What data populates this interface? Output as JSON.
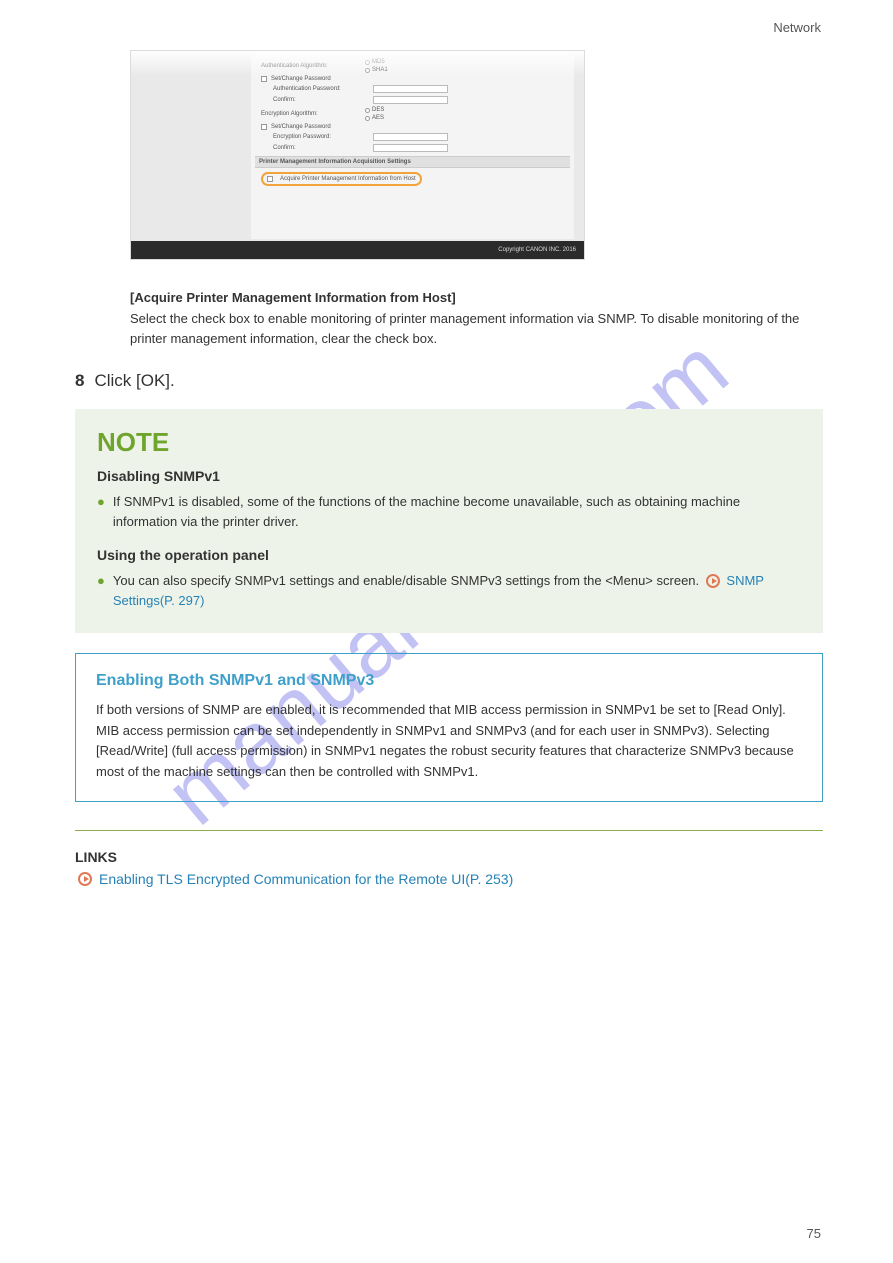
{
  "header": {
    "category": "Network"
  },
  "footer": {
    "page_number": "75"
  },
  "watermark": "manualshive.com",
  "screenshot": {
    "auth_algo_label": "Authentication Algorithm:",
    "auth_algo_opt1": "MD5",
    "auth_algo_opt2": "SHA1",
    "set_change_pw1": "Set/Change Password",
    "auth_pw_label": "Authentication Password:",
    "confirm1": "Confirm:",
    "enc_algo_label": "Encryption Algorithm:",
    "enc_algo_opt1": "DES",
    "enc_algo_opt2": "AES",
    "set_change_pw2": "Set/Change Password",
    "enc_pw_label": "Encryption Password:",
    "confirm2": "Confirm:",
    "section_header": "Printer Management Information Acquisition Settings",
    "highlight_label": "Acquire Printer Management Information from Host",
    "copyright": "Copyright CANON INC. 2016"
  },
  "option": {
    "title": "[Acquire Printer Management Information from Host]",
    "text": "Select the check box to enable monitoring of printer management information via SNMP. To disable monitoring of the printer management information, clear the check box."
  },
  "step": {
    "number": "8",
    "text": "Click [OK]."
  },
  "note": {
    "title": "NOTE",
    "subhead": "Disabling SNMPv1",
    "bullet_text_1": "If SNMPv1 is disabled, some of the functions of the machine become unavailable, such as obtaining machine information via the printer driver.",
    "panel_head": "Using the operation panel",
    "panel_bullet_1": "You can also specify SNMPv1 settings and enable/disable SNMPv3 settings from the <Menu> screen.",
    "panel_link": "SNMP Settings(P. 297)"
  },
  "opbox": {
    "title": "Enabling Both SNMPv1 and SNMPv3",
    "body": "If both versions of SNMP are enabled, it is recommended that MIB access permission in SNMPv1 be set to [Read Only]. MIB access permission can be set independently in SNMPv1 and SNMPv3 (and for each user in SNMPv3). Selecting [Read/Write] (full access permission) in SNMPv1 negates the robust security features that characterize SNMPv3 because most of the machine settings can then be controlled with SNMPv1."
  },
  "links": {
    "head": "LINKS",
    "item1": "Enabling TLS Encrypted Communication for the Remote UI(P. 253)"
  }
}
